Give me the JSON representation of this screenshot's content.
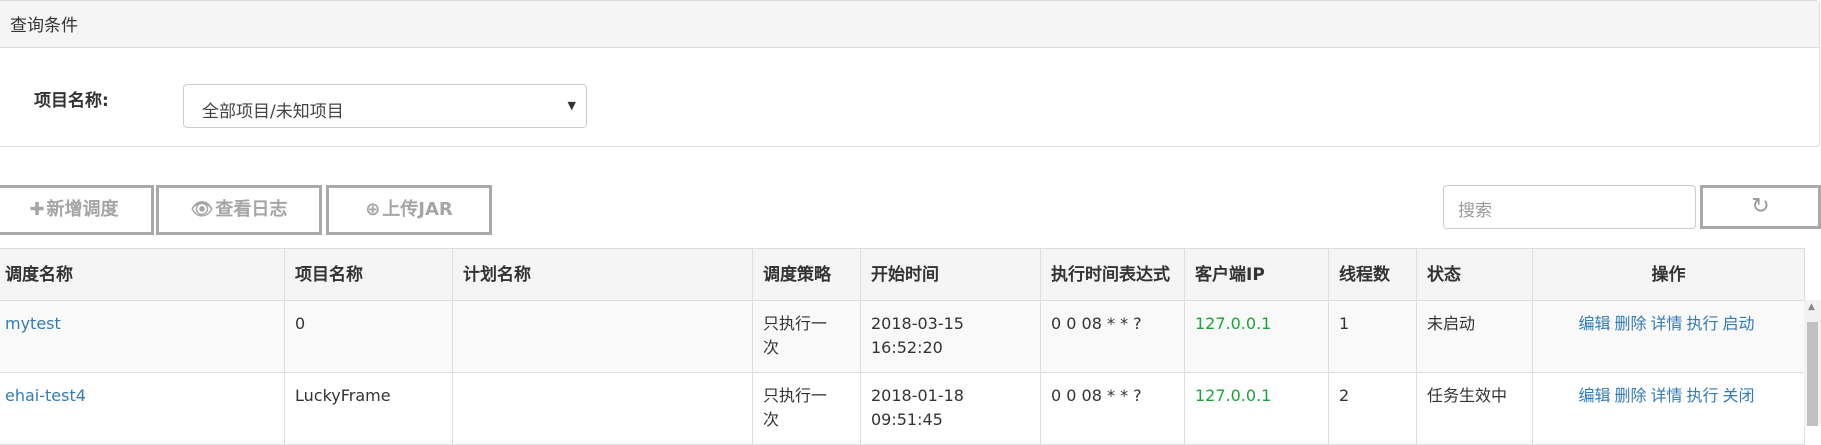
{
  "query_panel": {
    "title": "查询条件",
    "project_label": "项目名称:",
    "project_selected": "全部项目/未知项目"
  },
  "toolbar": {
    "add_label": "新增调度",
    "log_label": "查看日志",
    "upload_label": "上传JAR",
    "search_placeholder": "搜索"
  },
  "table": {
    "headers": [
      "调度名称",
      "项目名称",
      "计划名称",
      "调度策略",
      "开始时间",
      "执行时间表达式",
      "客户端IP",
      "线程数",
      "状态",
      "操作"
    ],
    "rows": [
      {
        "name": "mytest",
        "project": "0",
        "plan": "",
        "strategy_1": "只执行一",
        "strategy_2": "次",
        "start_date": "2018-03-15",
        "start_time": "16:52:20",
        "cron": "0 0 08 * * ?",
        "ip": "127.0.0.1",
        "threads": "1",
        "status": "未启动",
        "ops": [
          "编辑",
          "删除",
          "详情",
          "执行",
          "启动"
        ]
      },
      {
        "name": "ehai-test4",
        "project": "LuckyFrame",
        "plan": "",
        "strategy_1": "只执行一",
        "strategy_2": "次",
        "start_date": "2018-01-18",
        "start_time": "09:51:45",
        "cron": "0 0 08 * * ?",
        "ip": "127.0.0.1",
        "threads": "2",
        "status": "任务生效中",
        "ops": [
          "编辑",
          "删除",
          "详情",
          "执行",
          "关闭"
        ]
      }
    ]
  },
  "colors": {
    "link": "#337ab7",
    "ip": "#1aa33a",
    "button_border": "#a9a9a9"
  }
}
